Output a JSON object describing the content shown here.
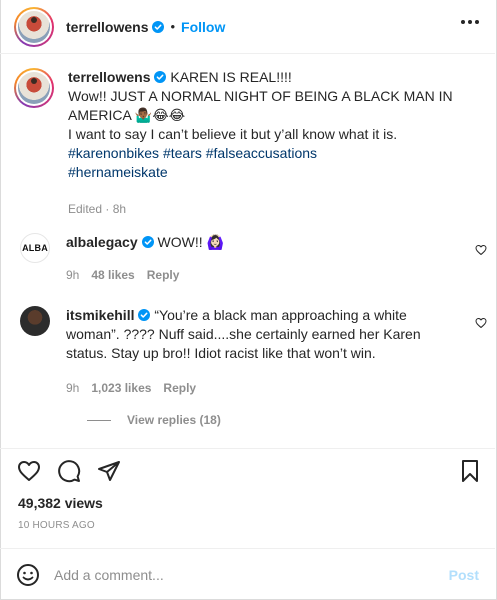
{
  "header": {
    "username": "terrellowens",
    "separator": "•",
    "follow_label": "Follow"
  },
  "caption": {
    "username": "terrellowens",
    "lines": [
      "KAREN IS REAL!!!!",
      "Wow!! JUST A NORMAL NIGHT OF BEING A BLACK MAN IN",
      "AMERICA 🤷🏾‍♂️😂😂",
      "I want to say I can’t believe it but y’all know what it is."
    ],
    "hashtags_line1": "#karenonbikes #tears #falseaccusations",
    "hashtags_line2": "#hernameiskate",
    "meta": "Edited · 8h"
  },
  "comments": [
    {
      "username": "albalegacy",
      "avatar_text": "ALBA",
      "text": "WOW!! 🙆🏻‍♀️",
      "time": "9h",
      "likes": "48 likes",
      "reply_label": "Reply"
    },
    {
      "username": "itsmikehill",
      "text_line1": "“You’re a black man approaching a white",
      "text_line2": "woman”. ???? Nuff said....she certainly earned her Karen",
      "text_line3": "status. Stay up bro!! Idiot racist like that won’t win.",
      "time": "9h",
      "likes": "1,023 likes",
      "reply_label": "Reply"
    }
  ],
  "view_replies": "View replies (18)",
  "stats": {
    "views": "49,382 views",
    "time_ago": "10 HOURS AGO"
  },
  "comment_box": {
    "placeholder": "Add a comment...",
    "post_label": "Post"
  },
  "colors": {
    "accent": "#0095f6",
    "verified": "#0095f6",
    "hashtag": "#00376b",
    "muted": "#8e8e8e",
    "post_disabled": "#b2dffc"
  },
  "icons": [
    "more-icon",
    "verified-icon",
    "heart-icon",
    "comment-icon",
    "share-icon",
    "bookmark-icon",
    "emoji-icon"
  ]
}
